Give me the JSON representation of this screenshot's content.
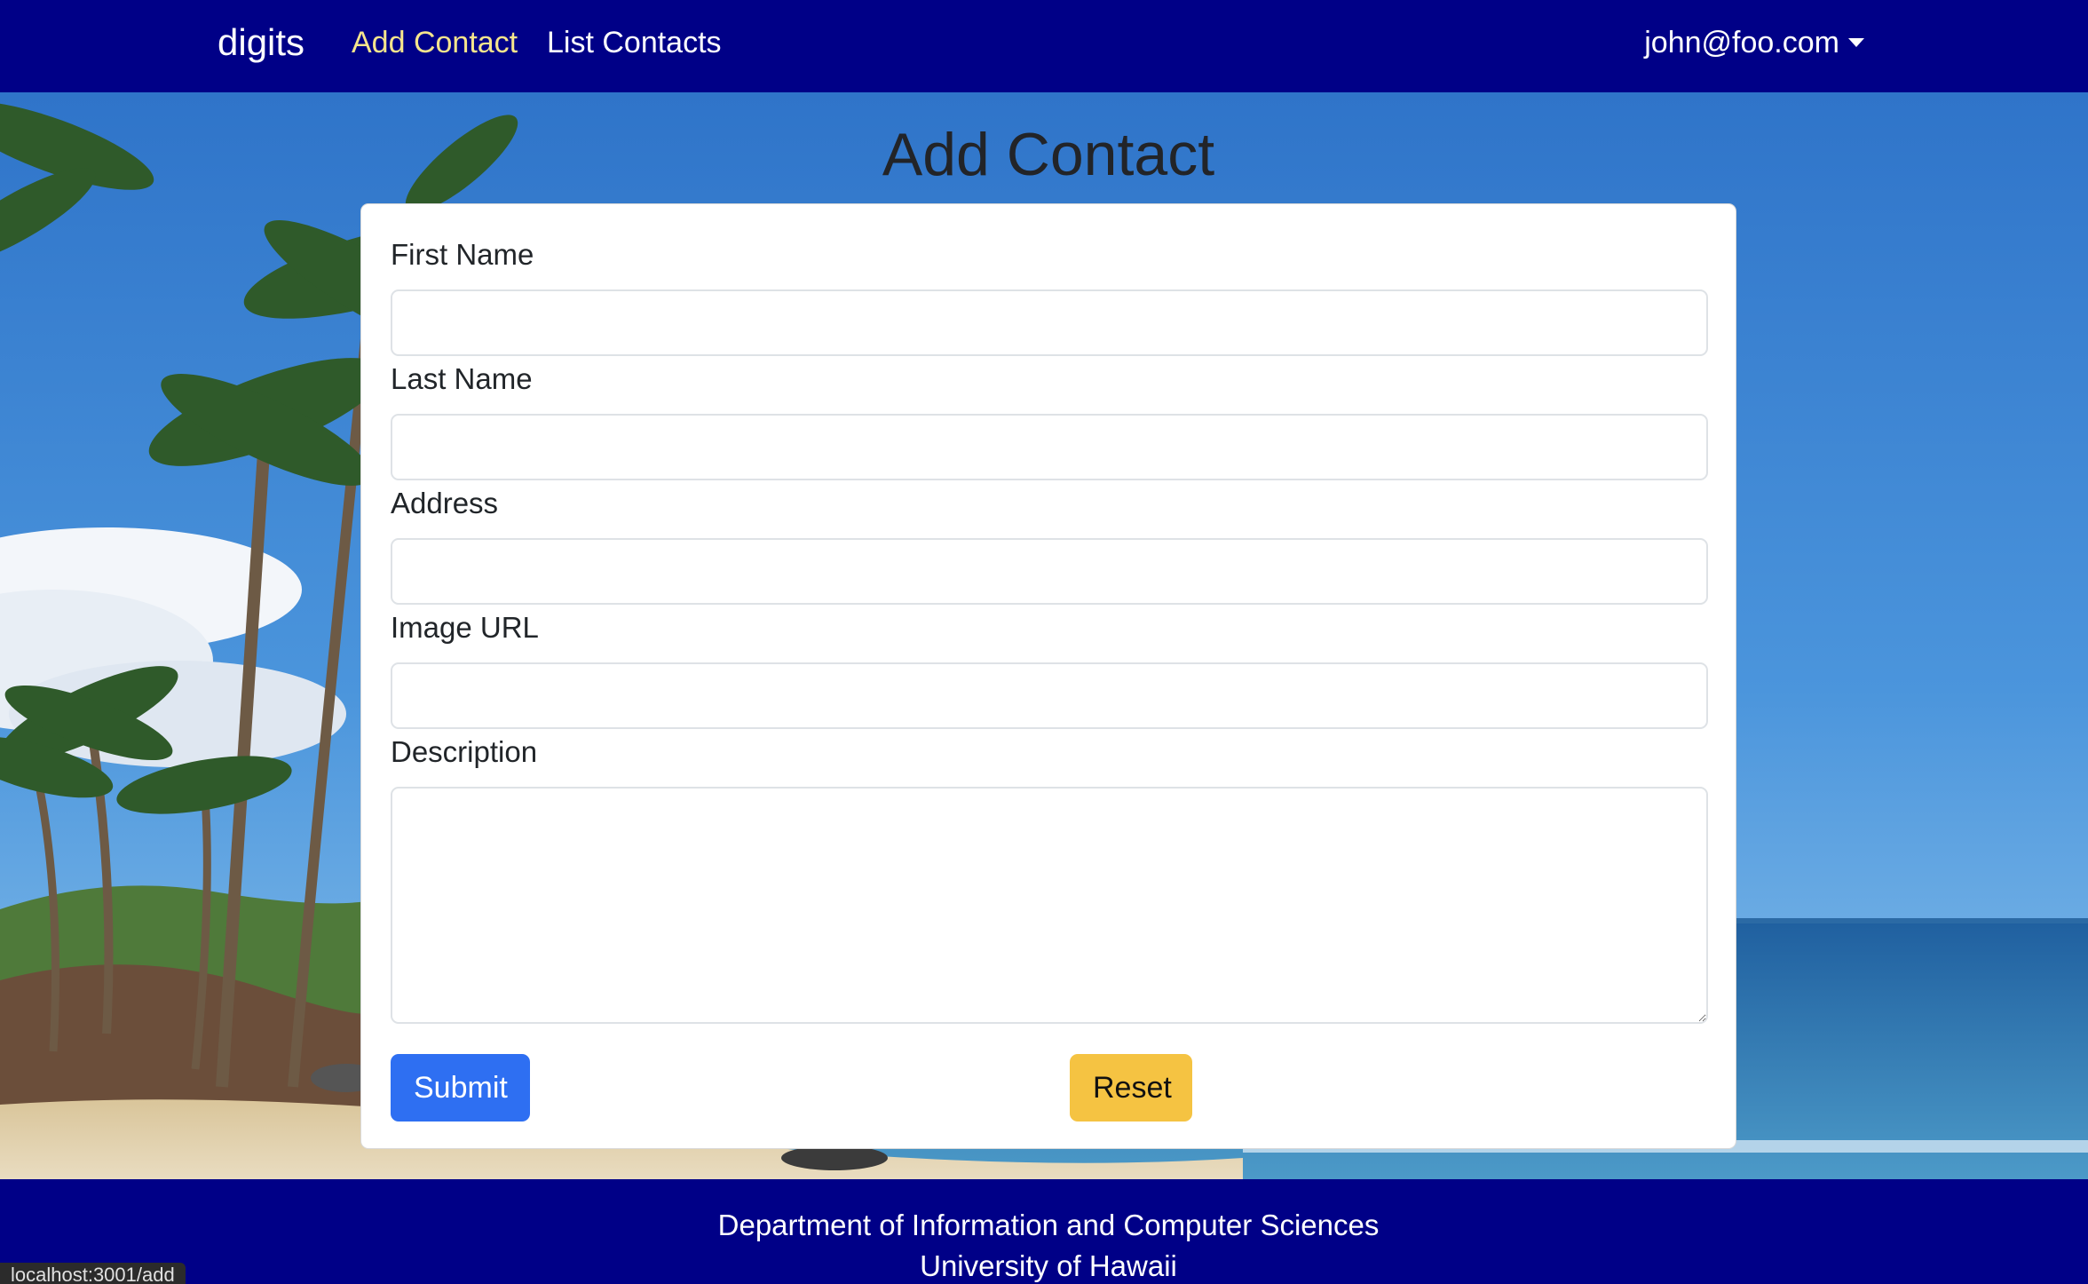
{
  "navbar": {
    "brand": "digits",
    "links": [
      {
        "label": "Add Contact",
        "active": true
      },
      {
        "label": "List Contacts",
        "active": false
      }
    ],
    "user": "john@foo.com"
  },
  "page": {
    "title": "Add Contact"
  },
  "form": {
    "fields": [
      {
        "label": "First Name",
        "value": ""
      },
      {
        "label": "Last Name",
        "value": ""
      },
      {
        "label": "Address",
        "value": ""
      },
      {
        "label": "Image URL",
        "value": ""
      },
      {
        "label": "Description",
        "value": ""
      }
    ],
    "submit_label": "Submit",
    "reset_label": "Reset"
  },
  "footer": {
    "line1": "Department of Information and Computer Sciences",
    "line2": "University of Hawaii"
  },
  "status_bar": {
    "url": "localhost:3001/add"
  },
  "colors": {
    "navbar": "#000087",
    "active_link": "#f6e58d",
    "submit": "#2e6ff2",
    "reset": "#f5c342"
  }
}
